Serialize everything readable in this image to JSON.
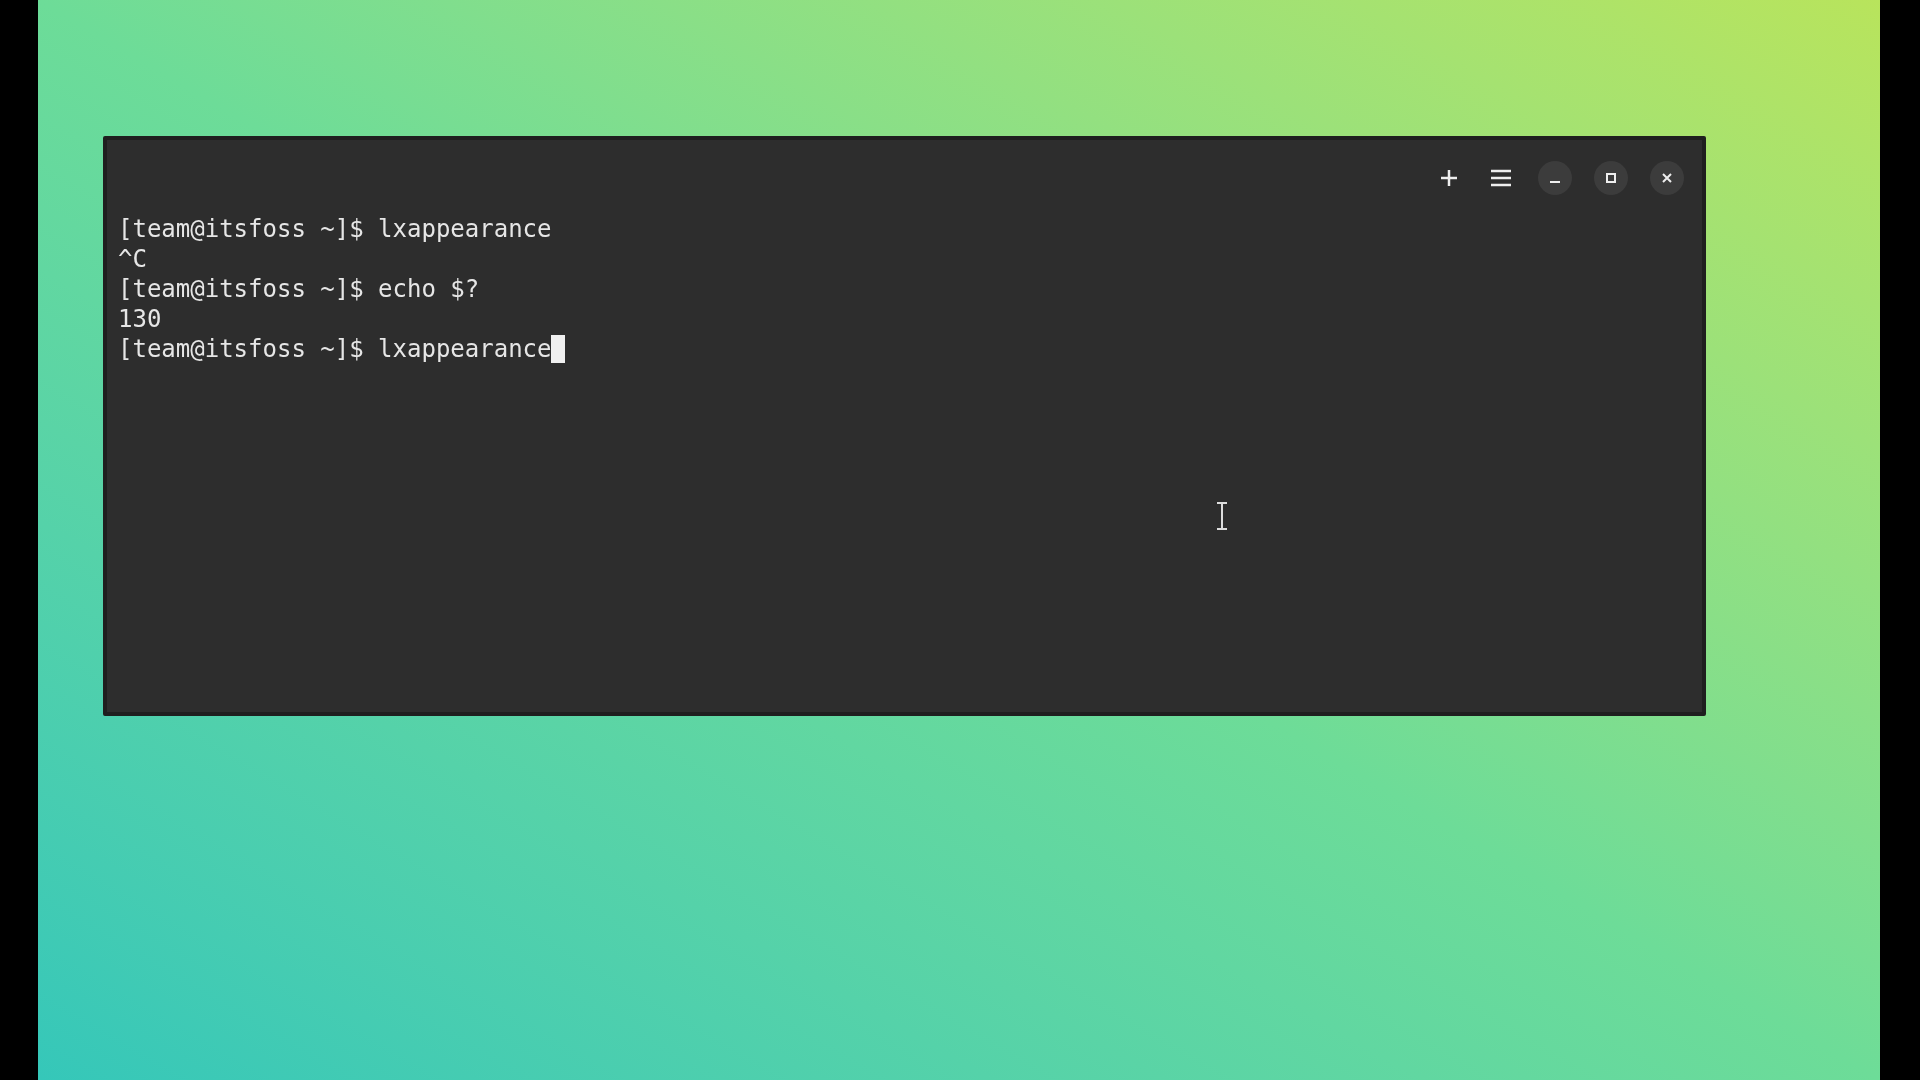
{
  "terminal": {
    "lines": [
      {
        "text": "[team@itsfoss ~]$ lxappearance",
        "cursor": false
      },
      {
        "text": "^C",
        "cursor": false
      },
      {
        "text": "[team@itsfoss ~]$ echo $?",
        "cursor": false
      },
      {
        "text": "130",
        "cursor": false
      },
      {
        "text": "[team@itsfoss ~]$ lxappearance",
        "cursor": true
      }
    ]
  }
}
